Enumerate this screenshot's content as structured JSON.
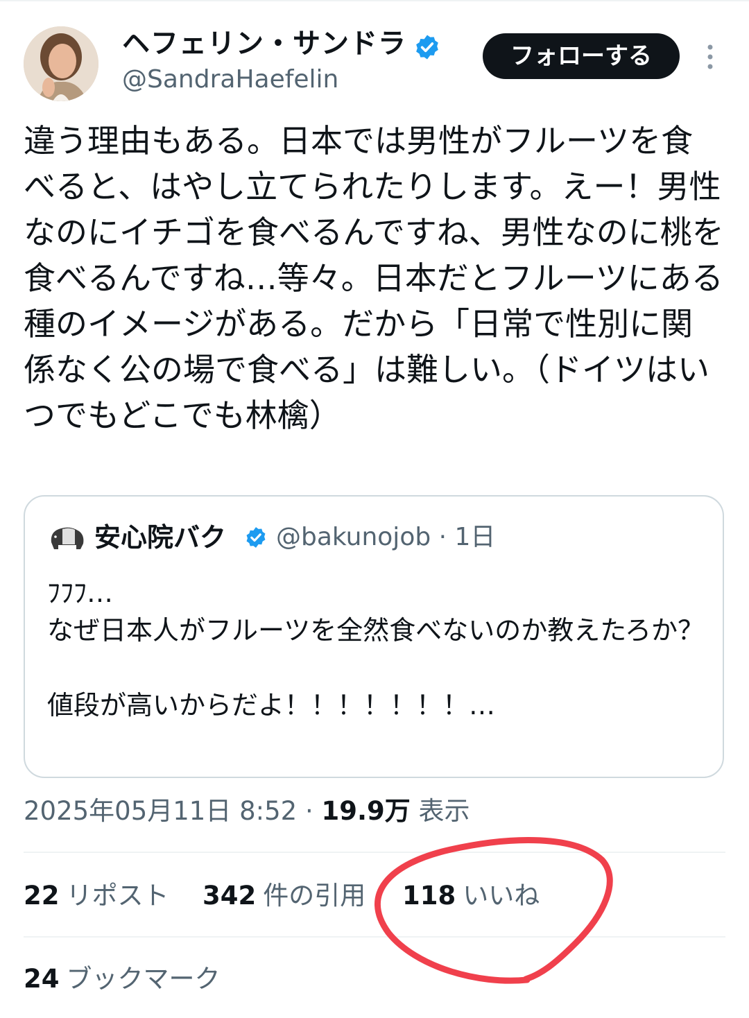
{
  "author": {
    "display_name": "ヘフェリン・サンドラ",
    "handle": "@SandraHaefelin",
    "follow_label": "フォローする"
  },
  "tweet": {
    "text": "違う理由もある。日本では男性がフルーツを食べると、はやし立てられたりします。えー！男性なのにイチゴを食べるんですね、男性なのに桃を食べるんですね…等々。日本だとフルーツにある種のイメージがある。だから「日常で性別に関係なく公の場で食べる」は難しい。（ドイツはいつでもどこでも林檎）"
  },
  "quote": {
    "display_name": "安心院バク",
    "handle_time": "@bakunojob · 1日",
    "text": "ﾌﾌﾌ…\nなぜ日本人がフルーツを全然食べないのか教えたろか？\n\n値段が高いからだよ！！！！！！！…"
  },
  "meta": {
    "timestamp": "2025年05月11日 8:52",
    "separator": " · ",
    "views_count": "19.9万",
    "views_label": "表示"
  },
  "stats": {
    "reposts_count": "22",
    "reposts_label": "リポスト",
    "quotes_count": "342",
    "quotes_label": "件の引用",
    "likes_count": "118",
    "likes_label": "いいね",
    "bookmarks_count": "24",
    "bookmarks_label": "ブックマーク"
  },
  "colors": {
    "verified": "#1d9bf0",
    "annotation": "#f0404c",
    "secondary_text": "#536471"
  }
}
